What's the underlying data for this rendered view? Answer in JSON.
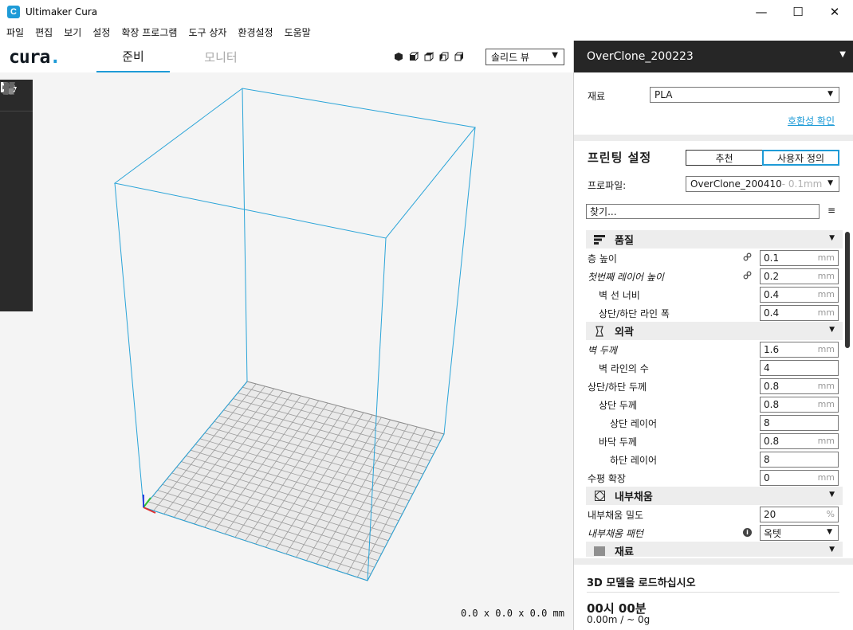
{
  "window": {
    "title": "Ultimaker Cura",
    "app_icon_letter": "C",
    "min_glyph": "—",
    "max_glyph": "☐",
    "close_glyph": "✕"
  },
  "menu": [
    "파일",
    "편집",
    "보기",
    "설정",
    "확장 프로그램",
    "도구 상자",
    "환경설정",
    "도움말"
  ],
  "header": {
    "logo_text": "cura",
    "logo_dot": ".",
    "tabs": [
      {
        "label": "준비",
        "active": true
      },
      {
        "label": "모니터",
        "active": false
      }
    ],
    "view_mode": "솔리드 뷰"
  },
  "viewport": {
    "dimensions": "0.0 x 0.0 x 0.0 mm",
    "accent_color": "#1e9bd7"
  },
  "tools": [
    "open-folder-icon",
    "move-icon",
    "scale-icon",
    "rotate-icon",
    "mirror-icon",
    "per-model-settings-icon",
    "support-blocker-icon"
  ],
  "panel": {
    "machine_name": "OverClone_200223",
    "material_label": "재료",
    "material_value": "PLA",
    "compat_link": "호환성 확인",
    "print_settings_title": "프린팅 설정",
    "mode_recommended": "추천",
    "mode_custom": "사용자 정의",
    "profile_label": "프로파일:",
    "profile_value": "OverClone_200410",
    "profile_suffix": " - 0.1mm",
    "search_placeholder": "찾기...",
    "menu_glyph": "≡",
    "categories": [
      {
        "label": "품질",
        "icon": "quality-icon",
        "rows": [
          {
            "label": "층 높이",
            "value": "0.1",
            "unit": "mm",
            "indent": 1,
            "italic": false,
            "linked": true
          },
          {
            "label": "첫번째 레이어 높이",
            "value": "0.2",
            "unit": "mm",
            "indent": 1,
            "italic": true,
            "linked": true
          },
          {
            "label": "벽 선 너비",
            "value": "0.4",
            "unit": "mm",
            "indent": 2,
            "italic": false,
            "linked": false
          },
          {
            "label": "상단/하단 라인 폭",
            "value": "0.4",
            "unit": "mm",
            "indent": 2,
            "italic": false,
            "linked": false
          }
        ]
      },
      {
        "label": "외곽",
        "icon": "shell-icon",
        "rows": [
          {
            "label": "벽 두께",
            "value": "1.6",
            "unit": "mm",
            "indent": 1,
            "italic": true,
            "linked": false
          },
          {
            "label": "벽 라인의 수",
            "value": "4",
            "unit": "",
            "indent": 2,
            "italic": false,
            "linked": false
          },
          {
            "label": "상단/하단 두께",
            "value": "0.8",
            "unit": "mm",
            "indent": 1,
            "italic": false,
            "linked": false
          },
          {
            "label": "상단 두께",
            "value": "0.8",
            "unit": "mm",
            "indent": 2,
            "italic": false,
            "linked": false
          },
          {
            "label": "상단 레이어",
            "value": "8",
            "unit": "",
            "indent": 3,
            "italic": false,
            "linked": false
          },
          {
            "label": "바닥 두께",
            "value": "0.8",
            "unit": "mm",
            "indent": 2,
            "italic": false,
            "linked": false
          },
          {
            "label": "하단 레이어",
            "value": "8",
            "unit": "",
            "indent": 3,
            "italic": false,
            "linked": false
          },
          {
            "label": "수평 확장",
            "value": "0",
            "unit": "mm",
            "indent": 1,
            "italic": false,
            "linked": false
          }
        ]
      },
      {
        "label": "내부채움",
        "icon": "infill-icon",
        "rows": [
          {
            "label": "내부채움 밀도",
            "value": "20",
            "unit": "%",
            "indent": 1,
            "italic": false,
            "linked": false
          },
          {
            "label": "내부채움 패턴",
            "value": "옥텟",
            "unit": "",
            "indent": 1,
            "italic": true,
            "linked": false,
            "info": true,
            "dropdown": true
          }
        ]
      },
      {
        "label": "재료",
        "icon": "material-icon",
        "rows": []
      }
    ],
    "load_message": "3D 모델을 로드하십시오",
    "print_time": "00시 00분",
    "print_amount": "0.00m / ~ 0g"
  }
}
